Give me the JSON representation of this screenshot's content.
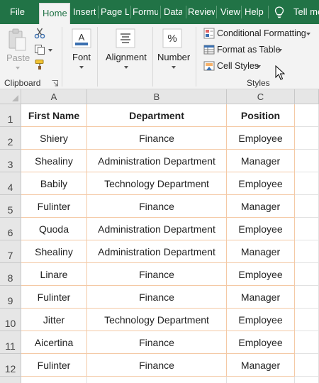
{
  "ribbon_tabs": {
    "file": "File",
    "home": "Home",
    "insert": "Insert",
    "page_layout": "Page L",
    "formulas": "Formu",
    "data": "Data",
    "review": "Review",
    "view": "View",
    "help": "Help",
    "tell_me": "Tell me"
  },
  "ribbon": {
    "clipboard": {
      "paste": "Paste",
      "label": "Clipboard"
    },
    "font": {
      "label": "Font"
    },
    "alignment": {
      "label": "Alignment"
    },
    "number": {
      "label": "Number"
    },
    "styles": {
      "conditional_formatting": "Conditional Formatting",
      "format_as_table": "Format as Table",
      "cell_styles": "Cell Styles",
      "label": "Styles"
    }
  },
  "sheet": {
    "columns": [
      "A",
      "B",
      "C"
    ],
    "rows": [
      "1",
      "2",
      "3",
      "4",
      "5",
      "6",
      "7",
      "8",
      "9",
      "10",
      "11",
      "12"
    ],
    "header": [
      "First Name",
      "Department",
      "Position"
    ],
    "data": [
      [
        "Shiery",
        "Finance",
        "Employee"
      ],
      [
        "Shealiny",
        "Administration Department",
        "Manager"
      ],
      [
        "Babily",
        "Technology Department",
        "Employee"
      ],
      [
        "Fulinter",
        "Finance",
        "Manager"
      ],
      [
        "Quoda",
        "Administration Department",
        "Employee"
      ],
      [
        "Shealiny",
        "Administration Department",
        "Manager"
      ],
      [
        "Linare",
        "Finance",
        "Employee"
      ],
      [
        "Fulinter",
        "Finance",
        "Manager"
      ],
      [
        "Jitter",
        "Technology Department",
        "Employee"
      ],
      [
        "Aicertina",
        "Finance",
        "Employee"
      ],
      [
        "Fulinter",
        "Finance",
        "Manager"
      ]
    ]
  },
  "colors": {
    "ribbon_green": "#217346",
    "table_border": "#f4c9a5"
  }
}
